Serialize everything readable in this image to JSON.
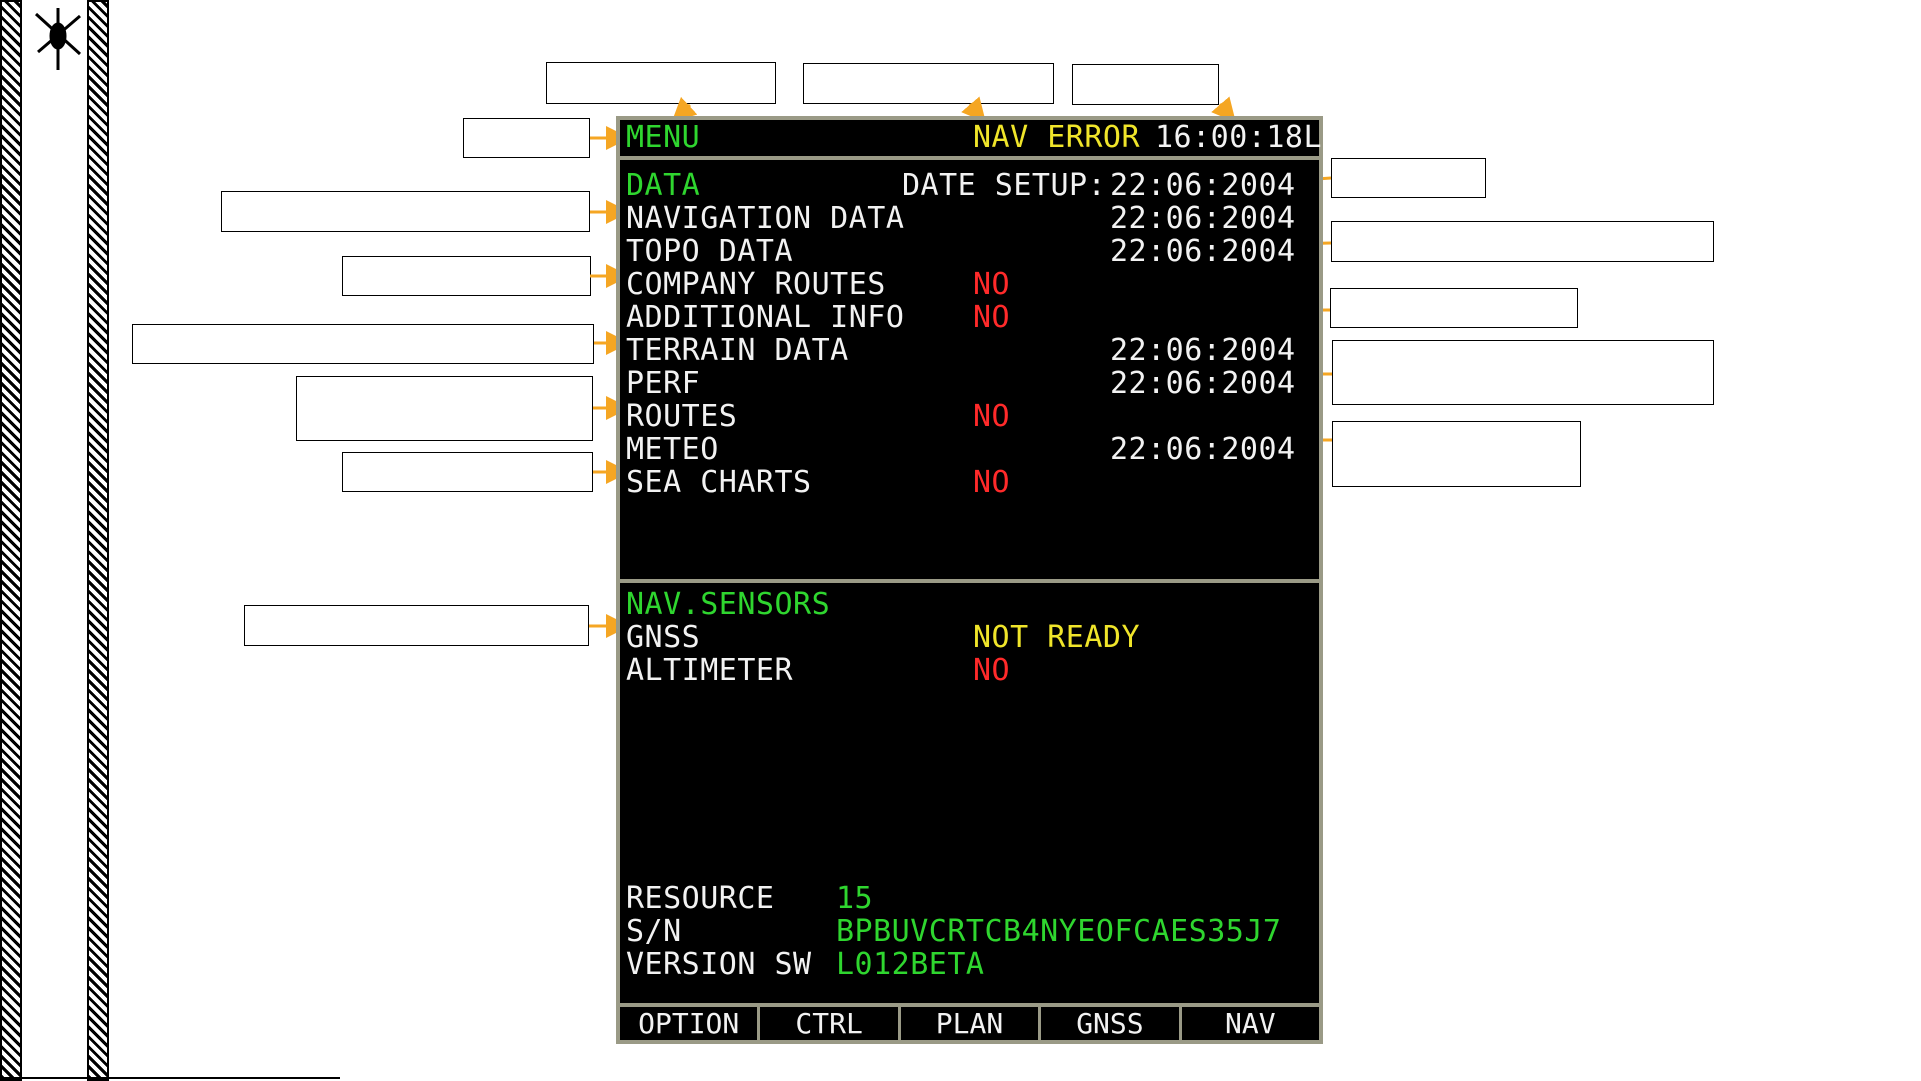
{
  "header": {
    "menu_label": "MENU",
    "status": "NAV ERROR",
    "clock": "16:00:18L"
  },
  "data_section": {
    "title": "DATA",
    "date_setup_label": "DATE SETUP:",
    "date_setup_value": "22:06:2004",
    "items": [
      {
        "label": "NAVIGATION DATA",
        "value": "22:06:2004",
        "status": "date"
      },
      {
        "label": "TOPO DATA",
        "value": "22:06:2004",
        "status": "date"
      },
      {
        "label": "COMPANY ROUTES",
        "value": "NO",
        "status": "no"
      },
      {
        "label": "ADDITIONAL INFO",
        "value": "NO",
        "status": "no"
      },
      {
        "label": "TERRAIN DATA",
        "value": "22:06:2004",
        "status": "date"
      },
      {
        "label": "PERF",
        "value": "22:06:2004",
        "status": "date"
      },
      {
        "label": "ROUTES",
        "value": "NO",
        "status": "no"
      },
      {
        "label": "METEO",
        "value": "22:06:2004",
        "status": "date"
      },
      {
        "label": "SEA CHARTS",
        "value": "NO",
        "status": "no"
      }
    ]
  },
  "sensors_section": {
    "title": "NAV.SENSORS",
    "items": [
      {
        "label": "GNSS",
        "value": "NOT READY",
        "status": "warning"
      },
      {
        "label": "ALTIMETER",
        "value": "NO",
        "status": "no"
      }
    ]
  },
  "system_info": {
    "resource_label": "RESOURCE",
    "resource_value": "15",
    "sn_label": "S/N",
    "sn_value": "BPBUVCRTCB4NYEOFCAES35J7",
    "version_label": "VERSION SW",
    "version_value": "L012BETA"
  },
  "softkeys": [
    "OPTION",
    "CTRL",
    "PLAN",
    "GNSS",
    "NAV"
  ],
  "colors": {
    "green": "#2fd62f",
    "white": "#f2f2f2",
    "red": "#ff2a2a",
    "yellow": "#f0e52a",
    "arrow": "#f5a623",
    "bezel": "#9a9a86"
  },
  "icons": {
    "logo": "helicopter-icon"
  }
}
